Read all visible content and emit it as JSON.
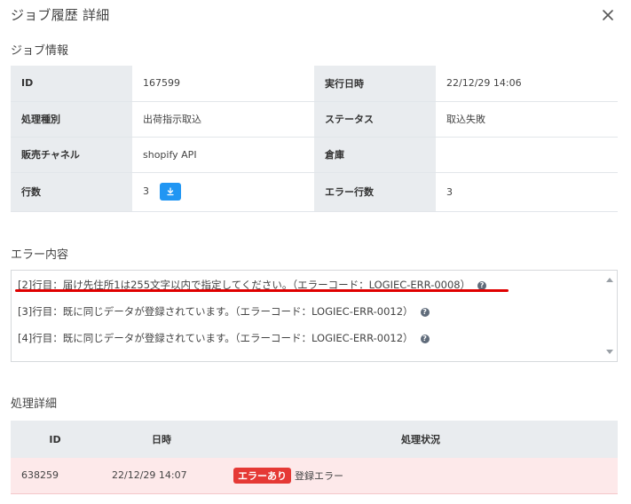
{
  "dialog": {
    "title": "ジョブ履歴 詳細"
  },
  "job_info": {
    "heading": "ジョブ情報",
    "rows": [
      {
        "k1": "ID",
        "v1": "167599",
        "k2": "実行日時",
        "v2": "22/12/29 14:06"
      },
      {
        "k1": "処理種別",
        "v1": "出荷指示取込",
        "k2": "ステータス",
        "v2": "取込失敗"
      },
      {
        "k1": "販売チャネル",
        "v1": "shopify API",
        "k2": "倉庫",
        "v2": ""
      },
      {
        "k1": "行数",
        "v1": "3",
        "k2": "エラー行数",
        "v2": "3"
      }
    ]
  },
  "errors": {
    "heading": "エラー内容",
    "lines": [
      "[2]行目：届け先住所1は255文字以内で指定してください。（エラーコード：LOGIEC-ERR-0008）",
      "[3]行目：既に同じデータが登録されています。（エラーコード：LOGIEC-ERR-0012）",
      "[4]行目：既に同じデータが登録されています。（エラーコード：LOGIEC-ERR-0012）"
    ],
    "help_glyph": "?"
  },
  "process": {
    "heading": "処理詳細",
    "columns": [
      "ID",
      "日時",
      "処理状況"
    ],
    "rows": [
      {
        "id": "638259",
        "datetime": "22/12/29 14:07",
        "badge": "エラーあり",
        "status": "登録エラー"
      }
    ]
  },
  "colors": {
    "accent": "#2196f3",
    "error": "#e53935",
    "underline": "#e00000",
    "error_row_bg": "#fde9ea"
  },
  "icons": {
    "close": "close-icon",
    "download": "download-icon",
    "help": "help-circle-icon"
  }
}
